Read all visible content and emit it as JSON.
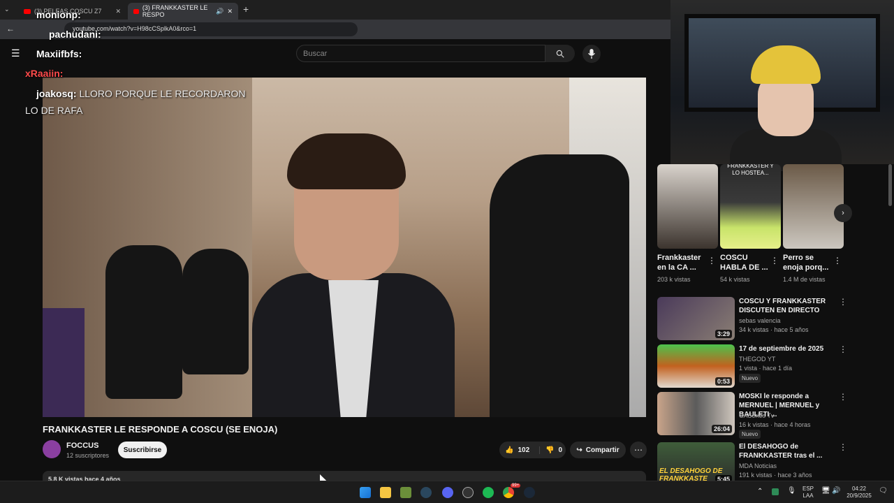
{
  "browser": {
    "tabs": [
      {
        "title": "(3) PELEAS COSCU Z7"
      },
      {
        "title": "(3) FRANKKASTER LE RESPO"
      }
    ],
    "new_tab": "+",
    "address": "youtube.com/watch?v=H98cCSplkA0&rco=1"
  },
  "masthead": {
    "search_placeholder": "Buscar"
  },
  "chat": [
    {
      "user": "monionp:",
      "msg": ""
    },
    {
      "user": "pachudani:",
      "msg": ""
    },
    {
      "user": "Maxiifbfs:",
      "msg": ""
    },
    {
      "user": "xRaaiin:",
      "msg": ""
    },
    {
      "user": "joakosq:",
      "msg": "LLORO PORQUE LE RECORDARON"
    },
    {
      "user": "",
      "msg": "LO DE RAFA"
    }
  ],
  "video": {
    "title": "FRANKKASTER LE RESPONDE A COSCU (SE ENOJA)",
    "channel": "FOCCUS",
    "subscribers": "12 suscriptores",
    "subscribe_label": "Suscribirse",
    "likes": "102",
    "dislikes": "0",
    "share_label": "Compartir",
    "more": "⋯",
    "description": "5,8 K vistas  hace 4 años"
  },
  "shorts": [
    {
      "title": "Frankkaster en la CA ...",
      "views": "203 k vistas"
    },
    {
      "title": "COSCU HABLA DE ...",
      "views": "54 k vistas",
      "overlay": "FRANKKASTER Y LO HOSTEA..."
    },
    {
      "title": "Perro se enoja porq...",
      "views": "1.4 M de vistas"
    }
  ],
  "recommendations": [
    {
      "title": "COSCU Y FRANKKASTER DISCUTEN EN DIRECTO",
      "channel": "sebas valencia",
      "meta": "34 k vistas · hace 5 años",
      "duration": "3:29",
      "badge": ""
    },
    {
      "title": "17 de septiembre de 2025",
      "channel": "THEGOD YT",
      "meta": "1 vista · hace 1 día",
      "duration": "0:53",
      "badge": "Nuevo"
    },
    {
      "title": "MOSKI le responde a MERNUEL | MERNUEL y BAULETI ...",
      "channel": "CASeries Tv",
      "meta": "16 k vistas · hace 4 horas",
      "duration": "26:04",
      "badge": "Nuevo"
    },
    {
      "title": "El DESAHOGO de FRANKKASTER tras el ...",
      "channel": "MDA Noticias",
      "meta": "191 k vistas · hace 3 años",
      "duration": "5:45",
      "badge": "",
      "thumb_text": "EL DESAHOGO DE FRANKKASTE"
    }
  ],
  "taskbar": {
    "lang_top": "ESP",
    "lang_bottom": "LAA",
    "time": "04:22",
    "date": "20/9/2025",
    "chrome_badge": "99+"
  },
  "colors": {
    "accent": "#ff0000",
    "background": "#0f0f0f",
    "chip": "#272727"
  }
}
